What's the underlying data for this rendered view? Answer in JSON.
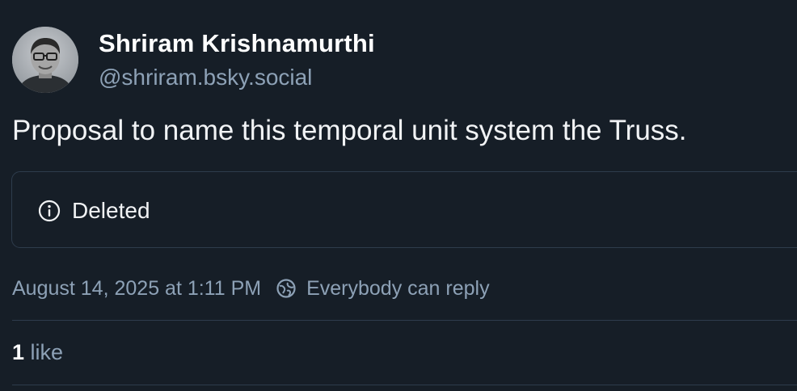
{
  "author": {
    "display_name": "Shriram Krishnamurthi",
    "handle": "@shriram.bsky.social",
    "avatar_icon": "person-photo"
  },
  "post": {
    "text": "Proposal to name this temporal unit system the Truss."
  },
  "embed": {
    "icon": "info-circle-icon",
    "label": "Deleted"
  },
  "meta": {
    "timestamp": "August 14, 2025 at 1:11 PM",
    "reply_icon": "globe-icon",
    "reply_setting": "Everybody can reply"
  },
  "engagement": {
    "likes_count": "1",
    "likes_label": "like"
  },
  "colors": {
    "background": "#161e27",
    "primary_text": "#f1f3f5",
    "secondary_text": "#8da1b6",
    "border": "#2e3c4c"
  }
}
